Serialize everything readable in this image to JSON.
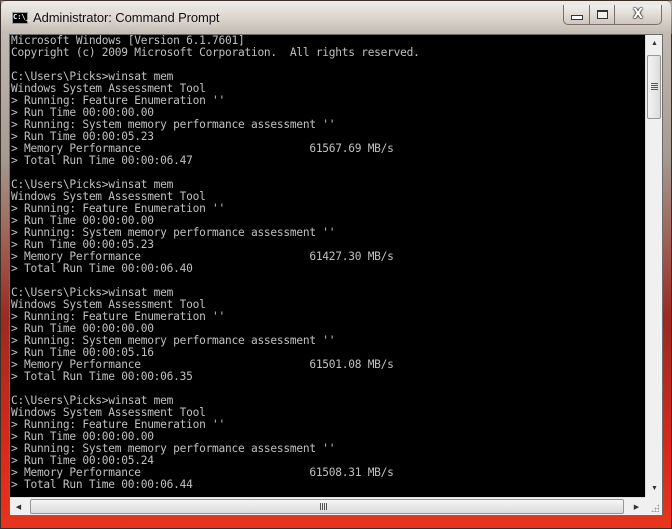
{
  "window": {
    "title": "Administrator: Command Prompt",
    "app_icon_text": "C:\\_",
    "caption_buttons": {
      "minimize_icon": "minimize-icon",
      "maximize_icon": "maximize-icon",
      "close_label": "X"
    }
  },
  "console": {
    "background_color": "#000000",
    "text_color": "#c0c0c0",
    "lines": [
      "Microsoft Windows [Version 6.1.7601]",
      "Copyright (c) 2009 Microsoft Corporation.  All rights reserved.",
      "",
      "C:\\Users\\Picks>winsat mem",
      "Windows System Assessment Tool",
      "> Running: Feature Enumeration ''",
      "> Run Time 00:00:00.00",
      "> Running: System memory performance assessment ''",
      "> Run Time 00:00:05.23",
      "> Memory Performance                          61567.69 MB/s",
      "> Total Run Time 00:00:06.47",
      "",
      "C:\\Users\\Picks>winsat mem",
      "Windows System Assessment Tool",
      "> Running: Feature Enumeration ''",
      "> Run Time 00:00:00.00",
      "> Running: System memory performance assessment ''",
      "> Run Time 00:00:05.23",
      "> Memory Performance                          61427.30 MB/s",
      "> Total Run Time 00:00:06.40",
      "",
      "C:\\Users\\Picks>winsat mem",
      "Windows System Assessment Tool",
      "> Running: Feature Enumeration ''",
      "> Run Time 00:00:00.00",
      "> Running: System memory performance assessment ''",
      "> Run Time 00:00:05.16",
      "> Memory Performance                          61501.08 MB/s",
      "> Total Run Time 00:00:06.35",
      "",
      "C:\\Users\\Picks>winsat mem",
      "Windows System Assessment Tool",
      "> Running: Feature Enumeration ''",
      "> Run Time 00:00:00.00",
      "> Running: System memory performance assessment ''",
      "> Run Time 00:00:05.24",
      "> Memory Performance                          61508.31 MB/s",
      "> Total Run Time 00:00:06.44"
    ]
  },
  "scrollbars": {
    "vertical": {
      "up_arrow": "▲",
      "down_arrow": "▼",
      "position": 0
    },
    "horizontal": {
      "left_arrow": "◀",
      "right_arrow": "▶",
      "position": 0
    }
  }
}
